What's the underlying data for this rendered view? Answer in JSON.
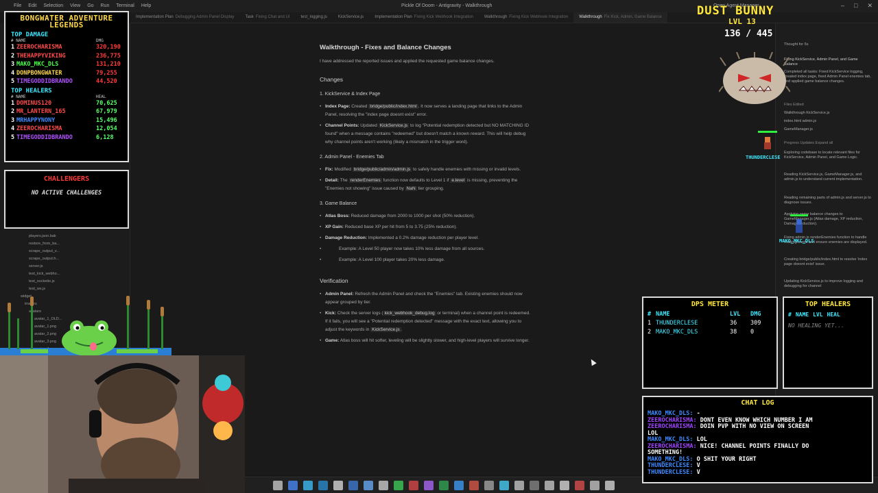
{
  "titlebar": {
    "menu": [
      "File",
      "Edit",
      "Selection",
      "View",
      "Go",
      "Run",
      "Terminal",
      "Help"
    ],
    "window_title": "Pickle Of Doom - Antigravity - Walkthrough",
    "right_info": "Open Agent Manager"
  },
  "tabs": [
    {
      "label": "Implementation Plan",
      "sub": "Debugging Admin Panel Display"
    },
    {
      "label": "Task",
      "sub": "Fixing Chat and UI"
    },
    {
      "label": "test_logging.js",
      "sub": ""
    },
    {
      "label": "KickService.js",
      "sub": ""
    },
    {
      "label": "Implementation Plan",
      "sub": "Fixing Kick Webhook Integration"
    },
    {
      "label": "Walkthrough",
      "sub": "Fixing Kick Webhook Integration"
    },
    {
      "label": "Walkthrough",
      "sub": "Fix Kick, Admin, Game Balance"
    }
  ],
  "explorer": {
    "files": [
      "players.json.bak",
      "restore_from_ba...",
      "scrape_output_v...",
      "scrape_output.h...",
      "server.js",
      "test_kick_webho...",
      "test_socketio.js",
      "test_ws.js",
      "widget",
      "images",
      "avatars",
      "avatar_1_OLD...",
      "avatar_1.png",
      "avatar_2.png",
      "avatar_3.png",
      "avatar_4.png"
    ]
  },
  "doc": {
    "title": "Walkthrough - Fixes and Balance Changes",
    "intro": "I have addressed the reported issues and applied the requested game balance changes.",
    "changes_heading": "Changes",
    "s1": {
      "heading": "1. KickService & Index Page",
      "b1_label": "Index Page:",
      "b1_pre": "Created",
      "b1_code": "bridge/public/index.html",
      "b1_post": ". It now serves a landing page that links to the Admin Panel, resolving the \"index page doesnt exist\" error.",
      "b2_label": "Channel Points:",
      "b2_pre": "Updated",
      "b2_code": "KickService.js",
      "b2_post": "to log \"Potential redemption detected but NO MATCHING ID found\" when a message contains \"redeemed\" but doesn't match a known reward. This will help debug why channel points aren't working (likely a mismatch in the trigger word)."
    },
    "s2": {
      "heading": "2. Admin Panel - Enemies Tab",
      "b1_label": "Fix:",
      "b1_pre": "Modified",
      "b1_code": "bridge/public/admin/admin.js",
      "b1_post": "to safely handle enemies with missing or invalid levels.",
      "b2_label": "Detail:",
      "b2_pre": "The",
      "b2_code": "renderEnemies",
      "b2_mid": "function now defaults to Level 1 if",
      "b2_code2": "e.level",
      "b2_mid2": "is missing, preventing the \"Enemies not showing\" issue caused by",
      "b2_code3": "NaN",
      "b2_post": "tier grouping."
    },
    "s3": {
      "heading": "3. Game Balance",
      "b1_label": "Atlas Boss:",
      "b1_text": "Reduced damage from 2000 to 1000 per shot (50% reduction).",
      "b2_label": "XP Gain:",
      "b2_text": "Reduced base XP per hit from 5 to 3.75 (25% reduction).",
      "b3_label": "Damage Reduction:",
      "b3_text": "Implemented a 0.2% damage reduction per player level.",
      "ex1": "Example: A Level 50 player now takes 10% less damage from all sources.",
      "ex2": "Example: A Level 100 player takes 20% less damage."
    },
    "verification": {
      "heading": "Verification",
      "b1_label": "Admin Panel:",
      "b1_text": "Refresh the Admin Panel and check the \"Enemies\" tab. Existing enemies should now appear grouped by tier.",
      "b2_label": "Kick:",
      "b2_pre": "Check the server logs (",
      "b2_code": "kick_webhook_debug.log",
      "b2_mid": "or terminal) when a channel point is redeemed. If it fails, you will see a \"Potential redemption detected\" message with the exact text, allowing you to adjust the keywords in",
      "b2_code2": "KickService.js",
      "b2_post": ".",
      "b3_label": "Game:",
      "b3_text": "Atlas boss will hit softer, leveling will be slightly slower, and high-level players will survive longer."
    }
  },
  "agent_panel": {
    "items": [
      "Thought for 5s",
      "Fixing KickService, Admin Panel, and Game Balance",
      "Completed all tasks: Fixed KickService logging, created index page, fixed Admin Panel enemies tab, and applied game balance changes.",
      "Files Edited",
      "Walkthrough  KickService.js",
      "index.html  admin.js",
      "GameManager.js",
      "Progress Updates   Expand all",
      "Exploring codebase to locate relevant files for KickService, Admin Panel, and Game Logic.",
      "Reading KickService.js, GameManager.js, and admin.js to understand current implementation.",
      "Reading remaining parts of admin.js and server.js to diagnose issues.",
      "Applying game balance changes to GameManager.js (Atlas damage, XP reduction, Damage reduction).",
      "Fixing admin.js renderEnemies function to handle missing levels and ensure enemies are displayed.",
      "Creating bridge/public/index.html to resolve 'index page doesnt exist' issue.",
      "Updating KickService.js to improve logging and debugging for channel"
    ]
  },
  "stats": {
    "title_line1": "BONGWATER ADVENTURE",
    "title_line2": "LEGENDS",
    "damage_heading": "TOP DAMAGE",
    "damage_col_name": "# NAME",
    "damage_col_val": "DMG",
    "damage": [
      {
        "rank": "1",
        "name": "ZEEROCHARISMA",
        "value": "320,190",
        "color": "#ff4a4a"
      },
      {
        "rank": "2",
        "name": "THEHAPPYVIKING",
        "value": "236,775",
        "color": "#ff4a4a"
      },
      {
        "rank": "3",
        "name": "MAKO_MKC_DLS",
        "value": "131,210",
        "color": "#4aff4a"
      },
      {
        "rank": "4",
        "name": "DONPBONGWATER",
        "value": "79,255",
        "color": "#ffd84a"
      },
      {
        "rank": "5",
        "name": "TIMEGODDIDBRANDO",
        "value": "44,520",
        "color": "#b050ff"
      }
    ],
    "heal_heading": "TOP HEALERS",
    "heal_col_name": "# NAME",
    "heal_col_val": "HEAL",
    "healers": [
      {
        "rank": "1",
        "name": "DOMINUS120",
        "value": "70,625",
        "color": "#ff4a4a"
      },
      {
        "rank": "2",
        "name": "MR_LANTERN_165",
        "value": "67,979",
        "color": "#ff4a4a"
      },
      {
        "rank": "3",
        "name": "MRHAPPYNONY",
        "value": "15,496",
        "color": "#3e8aff"
      },
      {
        "rank": "4",
        "name": "ZEEROCHARISMA",
        "value": "12,054",
        "color": "#ff4a4a"
      },
      {
        "rank": "5",
        "name": "TIMEGODDIDBRANDO",
        "value": "6,128",
        "color": "#b050ff"
      }
    ]
  },
  "challengers": {
    "title": "CHALLENGERS",
    "message": "NO ACTIVE CHALLENGES"
  },
  "boss": {
    "name": "DUST BUNNY",
    "level": "LVL 13",
    "hp": "136 / 445"
  },
  "player_tags": {
    "p1": "THUNDERCLESE",
    "p2": "MAKO_MKC_DLS"
  },
  "dps": {
    "title": "DPS METER",
    "col_rank": "#",
    "col_name": "NAME",
    "col_lvl": "LVL",
    "col_dmg": "DMG",
    "rows": [
      {
        "rank": "1",
        "name": "THUNDERCLESE",
        "lvl": "36",
        "dmg": "309"
      },
      {
        "rank": "2",
        "name": "MAKO_MKC_DLS",
        "lvl": "38",
        "dmg": "0"
      }
    ]
  },
  "top_healers_panel": {
    "title": "TOP HEALERS",
    "col_rank": "#",
    "col_name": "NAME",
    "col_lvl": "LVL",
    "col_heal": "HEAL",
    "empty": "NO HEALING YET..."
  },
  "chat": {
    "title": "CHAT LOG",
    "lines": [
      {
        "user": "MAKO_MKC_DLS:",
        "msg": "-",
        "ucolor": "#3e8aff"
      },
      {
        "user": "ZEEROCHARISMA:",
        "msg": "DONT EVEN KNOW WHICH NUMBER I AM",
        "ucolor": "#a044ff"
      },
      {
        "user": "ZEEROCHARISMA:",
        "msg": "DOIN PVP WITH NO VIEW ON SCREEN",
        "ucolor": "#a044ff"
      },
      {
        "user": "",
        "msg": "LOL",
        "ucolor": "#a044ff"
      },
      {
        "user": "MAKO_MKC_DLS:",
        "msg": "LOL",
        "ucolor": "#3e8aff"
      },
      {
        "user": "ZEEROCHARISMA:",
        "msg": "NICE! CHANNEL POINTS FINALLY DO",
        "ucolor": "#a044ff"
      },
      {
        "user": "",
        "msg": "SOMETHING!",
        "ucolor": "#a044ff"
      },
      {
        "user": "MAKO_MKC_DLS:",
        "msg": "O SHIT YOUR RIGHT",
        "ucolor": "#3e8aff"
      },
      {
        "user": "THUNDERCLESE:",
        "msg": "V",
        "ucolor": "#3e8aff"
      },
      {
        "user": "THUNDERCLESE:",
        "msg": "V",
        "ucolor": "#3e8aff"
      }
    ]
  },
  "taskbar": {
    "icon_colors": [
      "#cfcfcf",
      "#4a8cff",
      "#3ec5ff",
      "#2b8fd6",
      "#e0e0e0",
      "#3f7fd8",
      "#6ab0ff",
      "#d4d4d4",
      "#3fd25a",
      "#e04a4a",
      "#b06aff",
      "#33aa55",
      "#3fa0ff",
      "#e05a4a",
      "#aaaaaa",
      "#4ad4ff",
      "#cccccc",
      "#8a8a8a",
      "#cfcfcf",
      "#e0e0e0",
      "#e05050",
      "#cccccc",
      "#dddddd"
    ]
  }
}
